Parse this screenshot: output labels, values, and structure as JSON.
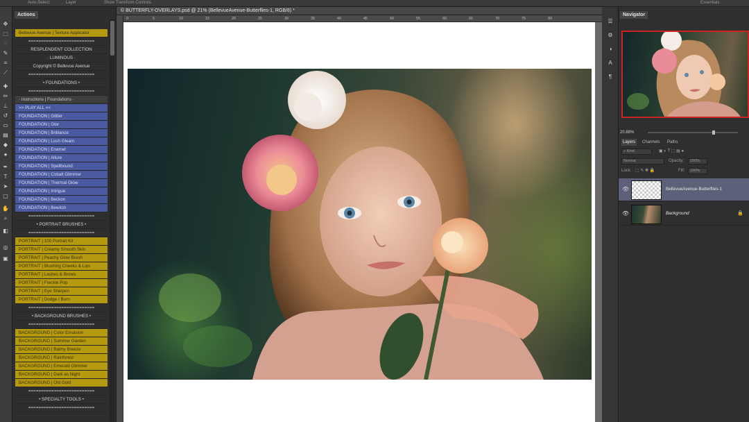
{
  "options_bar": {
    "auto_select": "Auto-Select:",
    "layer_select": "Layer",
    "transform": "Show Transform Controls",
    "workspace": "Essentials"
  },
  "actions_panel": {
    "tab": "Actions",
    "items": [
      {
        "label": "Bellevue Avenue | Texture Applicator",
        "style": "yellow"
      },
      {
        "label": "==========================",
        "style": "text"
      },
      {
        "label": "RESPLENDENT COLLECTION",
        "style": "text"
      },
      {
        "label": "· LUMINOUS ·",
        "style": "text"
      },
      {
        "label": "Copyright © Bellevue Avenue",
        "style": "text"
      },
      {
        "label": "==========================",
        "style": "text"
      },
      {
        "label": "•  FOUNDATIONS  •",
        "style": "header"
      },
      {
        "label": "==========================",
        "style": "text"
      },
      {
        "label": "· Instructions | Foundations ·",
        "style": "gray"
      },
      {
        "label": ">> PLAY ALL <<",
        "style": "blue"
      },
      {
        "label": "FOUNDATION | Glitter",
        "style": "blue"
      },
      {
        "label": "FOUNDATION | Glor",
        "style": "blue"
      },
      {
        "label": "FOUNDATION | Brilliance",
        "style": "blue"
      },
      {
        "label": "FOUNDATION | Lush Gleam",
        "style": "blue"
      },
      {
        "label": "FOUNDATION | Enamel",
        "style": "blue"
      },
      {
        "label": "FOUNDATION | Allure",
        "style": "blue"
      },
      {
        "label": "FOUNDATION | Spellbound",
        "style": "blue"
      },
      {
        "label": "FOUNDATION | Cobalt Glimmer",
        "style": "blue"
      },
      {
        "label": "FOUNDATION | Thermal Glow",
        "style": "blue"
      },
      {
        "label": "FOUNDATION | Intrigue",
        "style": "blue"
      },
      {
        "label": "FOUNDATION | Beckon",
        "style": "blue"
      },
      {
        "label": "FOUNDATION | Bewitch",
        "style": "blue"
      },
      {
        "label": "==========================",
        "style": "text"
      },
      {
        "label": "•  PORTRAIT BRUSHES  •",
        "style": "header"
      },
      {
        "label": "==========================",
        "style": "text"
      },
      {
        "label": "PORTRAIT | 100 Portrait Kit",
        "style": "yellow"
      },
      {
        "label": "PORTRAIT | Creamy Smooth Skin",
        "style": "yellow"
      },
      {
        "label": "PORTRAIT | Peachy Glow Brush",
        "style": "yellow"
      },
      {
        "label": "PORTRAIT | Blushing Cheeks & Lips",
        "style": "yellow"
      },
      {
        "label": "PORTRAIT | Lashes & Brows",
        "style": "yellow"
      },
      {
        "label": "PORTRAIT | Freckle Pop",
        "style": "yellow"
      },
      {
        "label": "PORTRAIT | Eye Sharpen",
        "style": "yellow"
      },
      {
        "label": "PORTRAIT | Dodge / Burn",
        "style": "yellow"
      },
      {
        "label": "==========================",
        "style": "text"
      },
      {
        "label": "•  BACKGROUND BRUSHES  •",
        "style": "header"
      },
      {
        "label": "==========================",
        "style": "text"
      },
      {
        "label": "BACKGROUND | Color Emulsion",
        "style": "yellow"
      },
      {
        "label": "BACKGROUND | Summer Garden",
        "style": "yellow"
      },
      {
        "label": "BACKGROUND | Balmy Breeze",
        "style": "yellow"
      },
      {
        "label": "BACKGROUND | Rainforest",
        "style": "yellow"
      },
      {
        "label": "BACKGROUND | Emerald Glimmer",
        "style": "yellow"
      },
      {
        "label": "BACKGROUND | Dark as Night",
        "style": "yellow"
      },
      {
        "label": "BACKGROUND | Old Gold",
        "style": "yellow"
      },
      {
        "label": "==========================",
        "style": "text"
      },
      {
        "label": "•  SPECIALTY TOOLS  •",
        "style": "header"
      },
      {
        "label": "==========================",
        "style": "text"
      }
    ]
  },
  "document": {
    "tab_title": "© BUTTERFLY-OVERLAYS.psd @ 21% (BellevueAvenue-Butterflies-1, RGB/8) *",
    "ruler_ticks": [
      "0",
      "5",
      "10",
      "15",
      "20",
      "25",
      "30",
      "35",
      "40",
      "45",
      "50",
      "55",
      "60",
      "65",
      "70",
      "75",
      "80"
    ]
  },
  "navigator": {
    "tab": "Navigator",
    "zoom": "20.88%"
  },
  "layers_panel": {
    "tabs": [
      "Layers",
      "Channels",
      "Paths"
    ],
    "kind_label": "Kind",
    "blend_mode": "Normal",
    "opacity_label": "Opacity:",
    "opacity_value": "100%",
    "lock_label": "Lock:",
    "fill_label": "Fill:",
    "fill_value": "100%",
    "layers": [
      {
        "name": "BellevueAvenue-Butterflies-1",
        "selected": true,
        "visible": true
      },
      {
        "name": "Background",
        "selected": false,
        "visible": true,
        "locked": true
      }
    ]
  },
  "colors": {
    "accent_yellow": "#b59a10",
    "accent_blue": "#4a5aa0",
    "selection": "#5c6078"
  }
}
